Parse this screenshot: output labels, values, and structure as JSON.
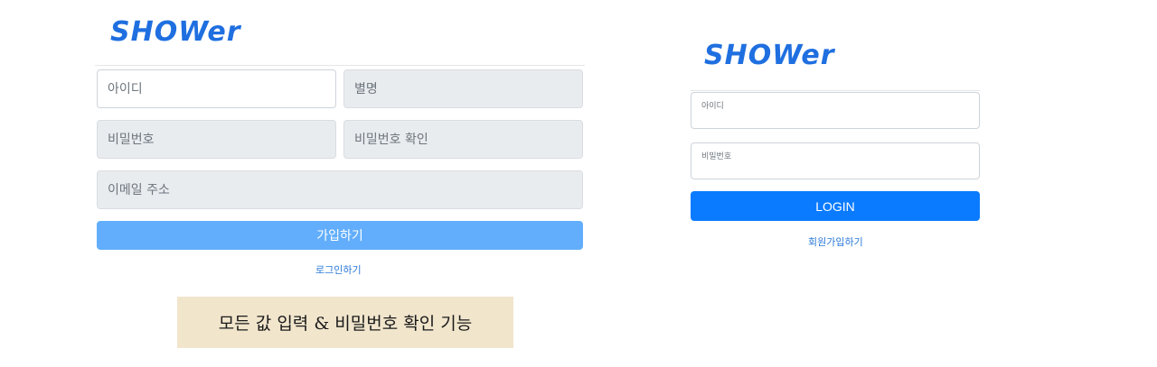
{
  "signup": {
    "logo": "SHOWer",
    "fields": {
      "id_placeholder": "아이디",
      "nickname_placeholder": "별명",
      "password_placeholder": "비밀번호",
      "password_confirm_placeholder": "비밀번호 확인",
      "email_placeholder": "이메일 주소"
    },
    "submit_label": "가입하기",
    "login_link": "로그인하기"
  },
  "caption": "모든 값 입력 & 비밀번호 확인 기능",
  "login": {
    "logo": "SHOWer",
    "id_label": "아이디",
    "password_label": "비밀번호",
    "submit_label": "LOGIN",
    "signup_link": "회원가입하기"
  },
  "colors": {
    "brand": "#1f6fe0",
    "join_button": "#62aefc",
    "login_button": "#0a7bff",
    "caption_bg": "#f1e5cc"
  }
}
